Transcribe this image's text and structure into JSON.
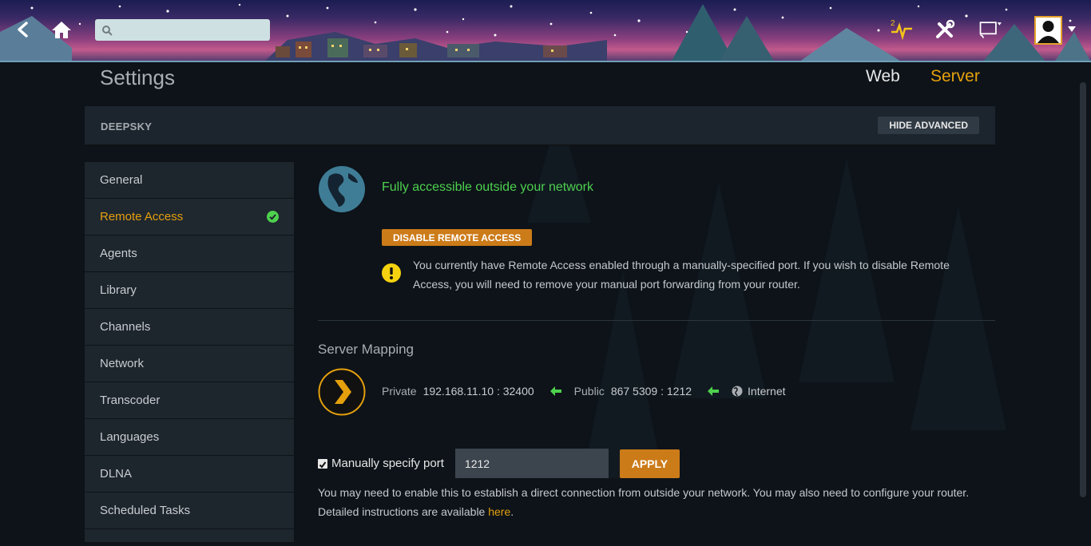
{
  "header": {
    "search": {
      "value": "",
      "placeholder": ""
    },
    "notification_count": "2"
  },
  "page": {
    "title": "Settings",
    "tabs": [
      {
        "label": "Web",
        "active": false
      },
      {
        "label": "Server",
        "active": true
      }
    ]
  },
  "server_bar": {
    "name": "DEEPSKY",
    "toggle_label": "HIDE ADVANCED"
  },
  "sidebar": {
    "items": [
      {
        "label": "General"
      },
      {
        "label": "Remote Access",
        "active": true,
        "status_icon": "check-circle-icon"
      },
      {
        "label": "Agents"
      },
      {
        "label": "Library"
      },
      {
        "label": "Channels"
      },
      {
        "label": "Network"
      },
      {
        "label": "Transcoder"
      },
      {
        "label": "Languages"
      },
      {
        "label": "DLNA"
      },
      {
        "label": "Scheduled Tasks"
      }
    ]
  },
  "remote_access": {
    "status": "Fully accessible outside your network",
    "disable_button": "DISABLE REMOTE ACCESS",
    "warning": "You currently have Remote Access enabled through a manually-specified port. If you wish to disable Remote Access, you will need to remove your manual port forwarding from your router."
  },
  "mapping": {
    "title": "Server Mapping",
    "private_label": "Private",
    "private_value": "192.168.11.10 : 32400",
    "public_label": "Public",
    "public_value": "867 5309 : 1212",
    "internet_label": "Internet"
  },
  "port": {
    "checkbox_label": "Manually specify port",
    "checked": true,
    "value": "1212",
    "apply_label": "APPLY",
    "help_text": "You may need to enable this to establish a direct connection from outside your network. You may also need to configure your router. Detailed instructions are available ",
    "help_link": "here",
    "help_end": "."
  },
  "colors": {
    "accent": "#e5a00d",
    "success": "#4ed14e",
    "button": "#cc7b19",
    "background": "#0d1319",
    "panel": "#1d252d"
  }
}
